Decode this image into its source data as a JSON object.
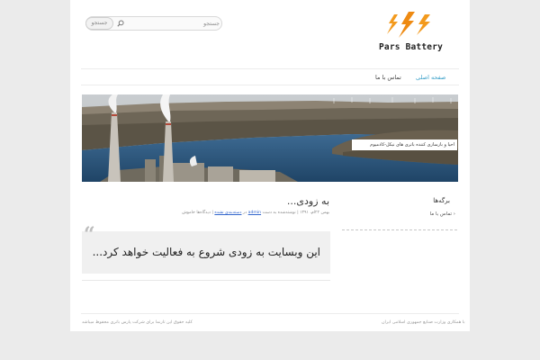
{
  "header": {
    "search_placeholder": "جستجو",
    "search_button_label": "جستجو",
    "logo_text": "Pars Battery"
  },
  "nav": {
    "items": [
      {
        "label": "صفحه اصلی",
        "active": true
      },
      {
        "label": "تماس با ما",
        "active": false
      }
    ]
  },
  "banner": {
    "caption": "احیا و بازسازی کننده باتری های نیکل-کادمیوم"
  },
  "post": {
    "title": "به زودی...",
    "meta_prefix": "بهمن ۲۲ام، ۱۳۹۱ | نوشته‌شده به دست",
    "meta_author": "admin",
    "meta_middle": "در",
    "meta_category": "دسته‌بندی نشده",
    "meta_comments": "| دیدگاه‌ها خاموش",
    "quote": "این وبسایت به زودی شروع به فعالیت خواهد کرد..."
  },
  "sidebar": {
    "widget_title": "برگه‌ها",
    "items": [
      "تماس با ما"
    ]
  },
  "footer": {
    "left": "کلیه حقوق این تارنما برای شرکت پارس باتری محفوظ میباشد",
    "right": "با همکاری وزارت صنایع جمهوری اسلامی ایران"
  },
  "colors": {
    "accent": "#3aa0c8",
    "logo_orange": "#f39a1d",
    "page_bg": "#ebebeb"
  }
}
